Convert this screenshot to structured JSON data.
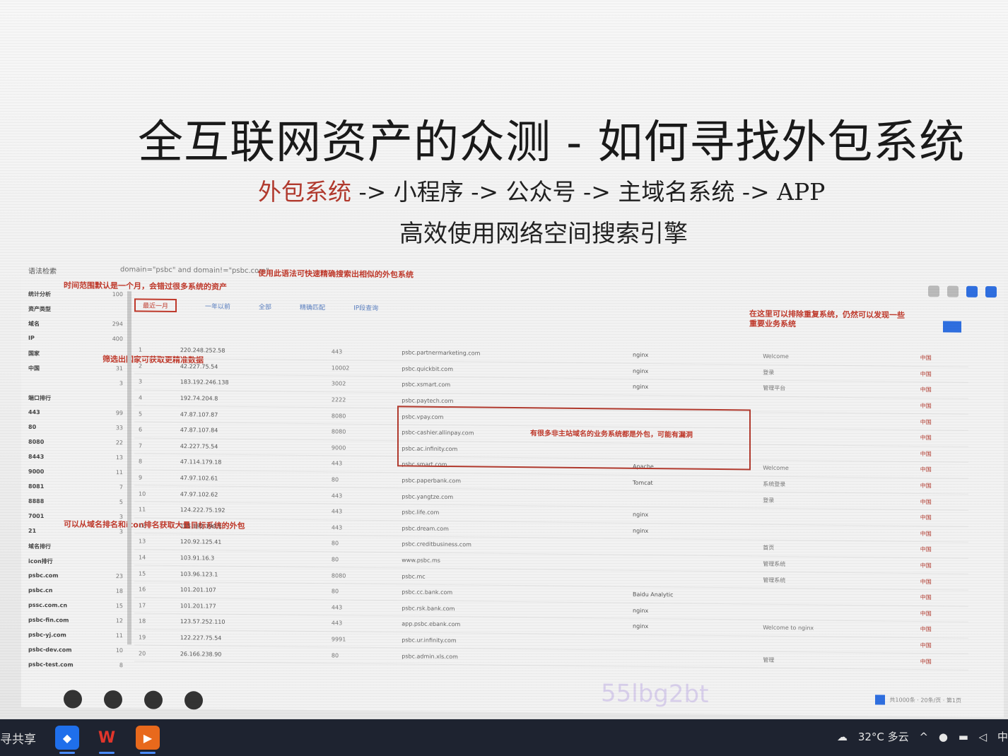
{
  "slide": {
    "title": "全互联网资产的众测 - 如何寻找外包系统",
    "flow_highlight": "外包系统",
    "flow_rest": " -> 小程序 -> 公众号 -> 主域名系统 -> APP",
    "subtitle": "高效使用网络空间搜索引擎"
  },
  "screenshot": {
    "search_label": "语法检索",
    "query": "domain=\"psbc\" and domain!=\"psbc.com\"",
    "query_tip": "使用此语法可快速精确搜索出相似的外包系统",
    "note_time": "时间范围默认是一个月，会错过很多系统的资产",
    "note_country": "筛选出国家可获取更精准数据",
    "note_domain": "可以从域名排名和icon排名获取大量目标系统的外包",
    "note_filter": "在这里可以排除重复系统，仍然可以发现一些重要业务系统",
    "red_box_note": "有很多非主站域名的业务系统都是外包，可能有漏洞",
    "watermark": "55lbg2bt",
    "sidebar": [
      {
        "label": "统计分析",
        "count": "100"
      },
      {
        "label": "资产类型",
        "count": ""
      },
      {
        "label": "域名",
        "count": "294"
      },
      {
        "label": "IP",
        "count": "400"
      },
      {
        "label": "国家",
        "count": ""
      },
      {
        "label": "中国",
        "count": "31"
      },
      {
        "label": "",
        "count": "3"
      },
      {
        "label": "端口排行",
        "count": ""
      },
      {
        "label": "443",
        "count": "99"
      },
      {
        "label": "80",
        "count": "33"
      },
      {
        "label": "8080",
        "count": "22"
      },
      {
        "label": "8443",
        "count": "13"
      },
      {
        "label": "9000",
        "count": "11"
      },
      {
        "label": "8081",
        "count": "7"
      },
      {
        "label": "8888",
        "count": "5"
      },
      {
        "label": "7001",
        "count": "3"
      },
      {
        "label": "21",
        "count": "3"
      },
      {
        "label": "域名排行",
        "count": ""
      },
      {
        "label": "icon排行",
        "count": ""
      },
      {
        "label": "psbc.com",
        "count": "23"
      },
      {
        "label": "psbc.cn",
        "count": "18"
      },
      {
        "label": "pssc.com.cn",
        "count": "15"
      },
      {
        "label": "psbc-fin.com",
        "count": "12"
      },
      {
        "label": "psbc-yj.com",
        "count": "11"
      },
      {
        "label": "psbc-dev.com",
        "count": "10"
      },
      {
        "label": "psbc-test.com",
        "count": "8"
      }
    ],
    "filters": [
      "最近一月",
      "一年以前",
      "全部",
      "精确匹配",
      "IP段查询"
    ],
    "rows": [
      {
        "n": "1",
        "ip": "220.248.252.58",
        "port": "443",
        "domain": "psbc.partnermarketing.com",
        "tag": "nginx",
        "title": "Welcome",
        "flag": "中国"
      },
      {
        "n": "2",
        "ip": "42.227.75.54",
        "port": "10002",
        "domain": "psbc.quickbit.com",
        "tag": "nginx",
        "title": "登录",
        "flag": "中国"
      },
      {
        "n": "3",
        "ip": "183.192.246.138",
        "port": "3002",
        "domain": "psbc.xsmart.com",
        "tag": "nginx",
        "title": "管理平台",
        "flag": "中国"
      },
      {
        "n": "4",
        "ip": "192.74.204.8",
        "port": "2222",
        "domain": "psbc.paytech.com",
        "tag": "",
        "title": "",
        "flag": "中国"
      },
      {
        "n": "5",
        "ip": "47.87.107.87",
        "port": "8080",
        "domain": "psbc.vpay.com",
        "tag": "",
        "title": "",
        "flag": "中国"
      },
      {
        "n": "6",
        "ip": "47.87.107.84",
        "port": "8080",
        "domain": "psbc-cashier.allinpay.com",
        "tag": "",
        "title": "",
        "flag": "中国"
      },
      {
        "n": "7",
        "ip": "42.227.75.54",
        "port": "9000",
        "domain": "psbc.ac.infinity.com",
        "tag": "",
        "title": "",
        "flag": "中国"
      },
      {
        "n": "8",
        "ip": "47.114.179.18",
        "port": "443",
        "domain": "psbc.smart.com",
        "tag": "Apache",
        "title": "Welcome",
        "flag": "中国"
      },
      {
        "n": "9",
        "ip": "47.97.102.61",
        "port": "80",
        "domain": "psbc.paperbank.com",
        "tag": "Tomcat",
        "title": "系统登录",
        "flag": "中国"
      },
      {
        "n": "10",
        "ip": "47.97.102.62",
        "port": "443",
        "domain": "psbc.yangtze.com",
        "tag": "",
        "title": "登录",
        "flag": "中国"
      },
      {
        "n": "11",
        "ip": "124.222.75.192",
        "port": "443",
        "domain": "psbc.life.com",
        "tag": "nginx",
        "title": "",
        "flag": "中国"
      },
      {
        "n": "12",
        "ip": "115.182.190.5",
        "port": "443",
        "domain": "psbc.dream.com",
        "tag": "nginx",
        "title": "",
        "flag": "中国"
      },
      {
        "n": "13",
        "ip": "120.92.125.41",
        "port": "80",
        "domain": "psbc.creditbusiness.com",
        "tag": "",
        "title": "首页",
        "flag": "中国"
      },
      {
        "n": "14",
        "ip": "103.91.16.3",
        "port": "80",
        "domain": "www.psbc.ms",
        "tag": "",
        "title": "管理系统",
        "flag": "中国"
      },
      {
        "n": "15",
        "ip": "103.96.123.1",
        "port": "8080",
        "domain": "psbc.mc",
        "tag": "",
        "title": "管理系统",
        "flag": "中国"
      },
      {
        "n": "16",
        "ip": "101.201.107",
        "port": "80",
        "domain": "psbc.cc.bank.com",
        "tag": "Baidu Analytic",
        "title": "",
        "flag": "中国"
      },
      {
        "n": "17",
        "ip": "101.201.177",
        "port": "443",
        "domain": "psbc.rsk.bank.com",
        "tag": "nginx",
        "title": "",
        "flag": "中国"
      },
      {
        "n": "18",
        "ip": "123.57.252.110",
        "port": "443",
        "domain": "app.psbc.ebank.com",
        "tag": "nginx",
        "title": "Welcome to nginx",
        "flag": "中国"
      },
      {
        "n": "19",
        "ip": "122.227.75.54",
        "port": "9991",
        "domain": "psbc.ur.infinity.com",
        "tag": "",
        "title": "",
        "flag": "中国"
      },
      {
        "n": "20",
        "ip": "26.166.238.90",
        "port": "80",
        "domain": "psbc.admin.xls.com",
        "tag": "",
        "title": "管理",
        "flag": "中国"
      }
    ],
    "pager": "共1000条 · 20条/页 · 第1页"
  },
  "taskbar": {
    "share_label": "寻共享",
    "apps": [
      "Lark",
      "WPS",
      "Slides"
    ],
    "weather": "32°C 多云",
    "ime": "中"
  }
}
